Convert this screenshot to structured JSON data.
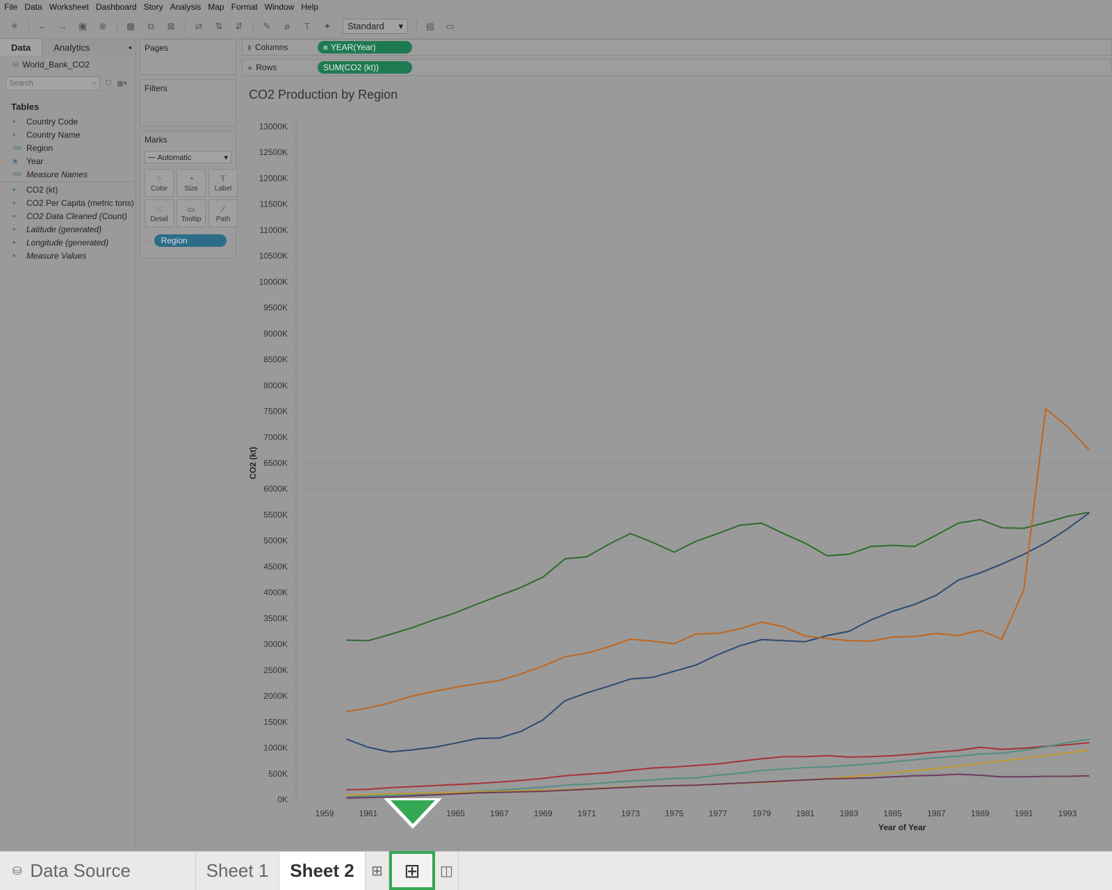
{
  "menu": [
    "File",
    "Data",
    "Worksheet",
    "Dashboard",
    "Story",
    "Analysis",
    "Map",
    "Format",
    "Window",
    "Help"
  ],
  "toolbar": {
    "fit_select": "Standard"
  },
  "left_pane": {
    "tab_data": "Data",
    "tab_analytics": "Analytics",
    "datasource": "World_Bank_CO2",
    "search_placeholder": "Search",
    "tables_heading": "Tables",
    "dimensions": [
      {
        "label": "Country Code",
        "icon": "globe-icon"
      },
      {
        "label": "Country Name",
        "icon": "globe-icon"
      },
      {
        "label": "Region",
        "icon": "abc-icon"
      },
      {
        "label": "Year",
        "icon": "calendar-icon"
      },
      {
        "label": "Measure Names",
        "icon": "abc-icon"
      }
    ],
    "measures": [
      {
        "label": "CO2 (kt)"
      },
      {
        "label": "CO2 Per Capita (metric tons)"
      },
      {
        "label": "CO2 Data Cleaned (Count)"
      },
      {
        "label": "Latitude (generated)"
      },
      {
        "label": "Longitude (generated)"
      },
      {
        "label": "Measure Values"
      }
    ]
  },
  "cards": {
    "pages": "Pages",
    "filters": "Filters",
    "marks": "Marks",
    "marks_type": "Automatic",
    "mark_buttons": [
      "Color",
      "Size",
      "Label",
      "Detail",
      "Tooltip",
      "Path"
    ],
    "region_pill": "Region"
  },
  "shelves": {
    "columns_label": "Columns",
    "columns_pill": "YEAR(Year)",
    "rows_label": "Rows",
    "rows_pill": "SUM(CO2 (kt))"
  },
  "colors": {
    "green": "#2e6b2a",
    "blue": "#2a4a70",
    "orange": "#c0651c",
    "red": "#a83232",
    "teal": "#4f8f86",
    "gold": "#c49a2a",
    "purple": "#6b3a5c"
  },
  "chart_data": {
    "type": "line",
    "title": "CO2 Production by Region",
    "xlabel": "Year of Year",
    "ylabel": "CO2 (kt)",
    "ylim": [
      0,
      13000
    ],
    "xlim": [
      1959,
      1994
    ],
    "x_ticks": [
      "1959",
      "1961",
      "1963",
      "1965",
      "1967",
      "1969",
      "1971",
      "1973",
      "1975",
      "1977",
      "1979",
      "1981",
      "1983",
      "1985",
      "1987",
      "1989",
      "1991",
      "1993"
    ],
    "y_ticks": [
      "0K",
      "500K",
      "1000K",
      "1500K",
      "2000K",
      "2500K",
      "3000K",
      "3500K",
      "4000K",
      "4500K",
      "5000K",
      "5500K",
      "6000K",
      "6500K",
      "7000K",
      "7500K",
      "8000K",
      "8500K",
      "9000K",
      "9500K",
      "10000K",
      "10500K",
      "11000K",
      "11500K",
      "12000K",
      "12500K",
      "13000K"
    ],
    "x": [
      1960,
      1961,
      1962,
      1963,
      1964,
      1965,
      1966,
      1967,
      1968,
      1969,
      1970,
      1971,
      1972,
      1973,
      1974,
      1975,
      1976,
      1977,
      1978,
      1979,
      1980,
      1981,
      1982,
      1983,
      1984,
      1985,
      1986,
      1987,
      1988,
      1989,
      1990,
      1991,
      1992,
      1993,
      1994
    ],
    "series": [
      {
        "color_key": "green",
        "values": [
          3080,
          3070,
          3190,
          3320,
          3470,
          3610,
          3780,
          3940,
          4100,
          4300,
          4650,
          4690,
          4930,
          5140,
          4970,
          4780,
          4990,
          5140,
          5300,
          5340,
          5140,
          4950,
          4710,
          4740,
          4890,
          4910,
          4890,
          5110,
          5340,
          5410,
          5250,
          5240,
          5350,
          5470,
          5550
        ]
      },
      {
        "color_key": "blue",
        "values": [
          1170,
          1010,
          920,
          960,
          1010,
          1090,
          1180,
          1190,
          1320,
          1540,
          1910,
          2060,
          2190,
          2330,
          2360,
          2480,
          2600,
          2800,
          2970,
          3090,
          3070,
          3050,
          3170,
          3250,
          3470,
          3640,
          3770,
          3950,
          4240,
          4380,
          4550,
          4740,
          4960,
          5230,
          5540
        ]
      },
      {
        "color_key": "orange",
        "values": [
          1700,
          1770,
          1870,
          2000,
          2090,
          2170,
          2240,
          2300,
          2430,
          2580,
          2760,
          2830,
          2950,
          3100,
          3060,
          3010,
          3200,
          3210,
          3300,
          3430,
          3340,
          3160,
          3110,
          3070,
          3060,
          3140,
          3150,
          3210,
          3170,
          3270,
          3100,
          4050,
          7550,
          7200,
          6750
        ]
      },
      {
        "color_key": "red",
        "values": [
          190,
          200,
          230,
          250,
          270,
          290,
          310,
          340,
          370,
          410,
          460,
          490,
          520,
          570,
          610,
          630,
          660,
          690,
          740,
          790,
          830,
          830,
          850,
          820,
          830,
          850,
          880,
          920,
          950,
          1010,
          970,
          990,
          1030,
          1060,
          1100
        ]
      },
      {
        "color_key": "teal",
        "values": [
          50,
          70,
          80,
          100,
          120,
          140,
          160,
          180,
          210,
          240,
          280,
          300,
          330,
          360,
          380,
          410,
          420,
          470,
          510,
          560,
          590,
          620,
          630,
          660,
          690,
          730,
          770,
          810,
          840,
          880,
          900,
          950,
          1020,
          1100,
          1170
        ]
      },
      {
        "color_key": "gold",
        "values": [
          90,
          100,
          110,
          120,
          130,
          140,
          150,
          160,
          170,
          180,
          190,
          210,
          230,
          250,
          260,
          270,
          280,
          300,
          310,
          330,
          350,
          380,
          410,
          440,
          480,
          520,
          560,
          600,
          650,
          700,
          750,
          800,
          850,
          900,
          960
        ]
      },
      {
        "color_key": "purple",
        "values": [
          30,
          40,
          50,
          70,
          90,
          110,
          130,
          140,
          150,
          160,
          180,
          200,
          220,
          240,
          260,
          270,
          280,
          300,
          320,
          340,
          360,
          380,
          400,
          410,
          420,
          440,
          460,
          470,
          490,
          470,
          440,
          440,
          450,
          450,
          460
        ]
      }
    ]
  },
  "tabs": {
    "data_source": "Data Source",
    "sheet1": "Sheet 1",
    "sheet2": "Sheet 2"
  }
}
